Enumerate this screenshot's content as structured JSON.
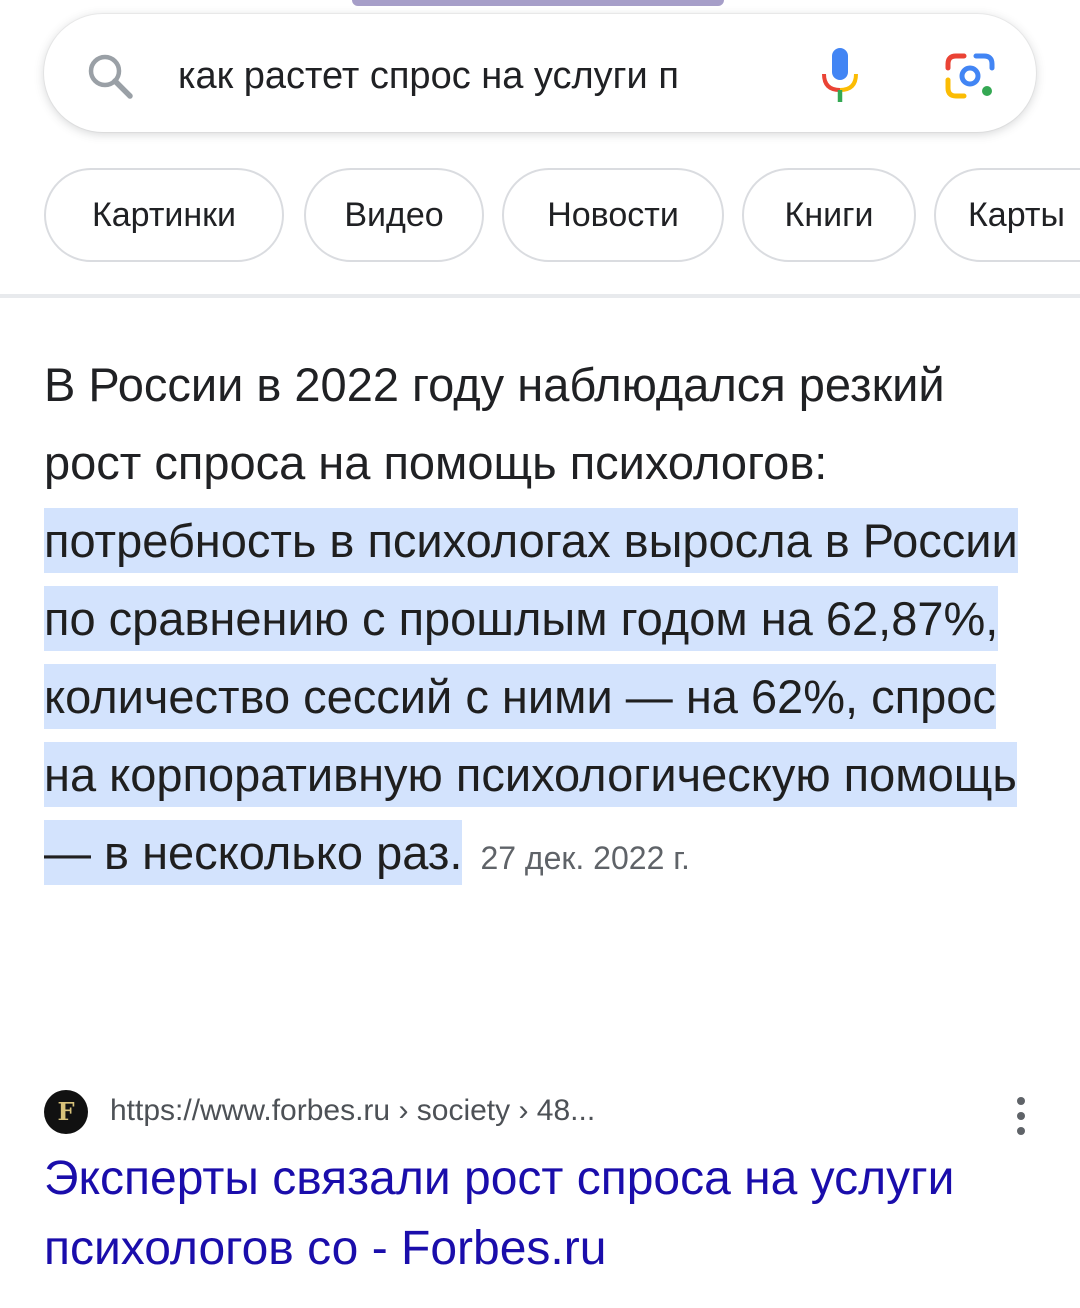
{
  "search": {
    "query": "как растет спрос на услуги п",
    "icon": "search-icon",
    "mic_icon": "microphone-icon",
    "lens_icon": "google-lens-icon"
  },
  "chips": [
    {
      "label": "Картинки"
    },
    {
      "label": "Видео"
    },
    {
      "label": "Новости"
    },
    {
      "label": "Книги"
    },
    {
      "label": "Карты"
    }
  ],
  "snippet": {
    "intro": "В России в 2022 году наблюдался резкий рост спроса на помощь психологов: ",
    "highlight": "потребность в психологах выросла в России по сравнению с прошлым годом на 62,87%, количество сессий с ними — на 62%, спрос на корпоративную психологическую помощь — в несколько раз",
    "highlight_end": ".",
    "date": "27 дек. 2022 г."
  },
  "result": {
    "favicon_letter": "F",
    "url": "https://www.forbes.ru › society › 48...",
    "title": "Эксперты связали рост спроса на услуги психологов со - Forbes.ru"
  },
  "colors": {
    "highlight": "#d3e3fd",
    "link": "#1a0dab",
    "google_blue": "#4285f4",
    "google_red": "#ea4335",
    "google_yellow": "#fbbc04",
    "google_green": "#34a853"
  }
}
